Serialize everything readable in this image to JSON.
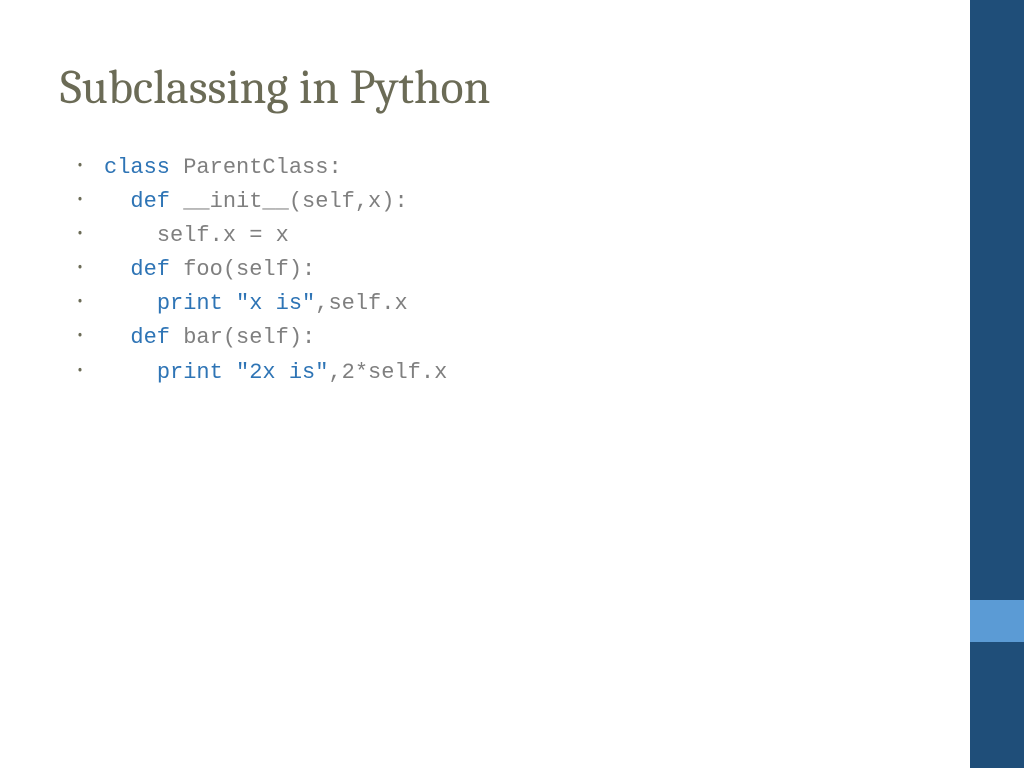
{
  "title": "Subclassing in Python",
  "code": {
    "line1": {
      "kw": "class",
      "rest": " ParentClass:"
    },
    "line2": {
      "pad": "  ",
      "kw": "def",
      "name": " __init__",
      "rest": "(self,x):"
    },
    "line3": {
      "pad": "    ",
      "rest": "self.x = x"
    },
    "line4": {
      "pad": "  ",
      "kw": "def",
      "rest": " foo(self):"
    },
    "line5": {
      "pad": "    ",
      "kw": "print",
      "sp": " ",
      "str": "\"x is\"",
      "rest": ",self.x"
    },
    "line6": {
      "pad": "  ",
      "kw": "def",
      "rest": " bar(self):"
    },
    "line7": {
      "pad": "    ",
      "kw": "print",
      "sp": " ",
      "str": "\"2x is\"",
      "rest": ",2*self.x"
    }
  }
}
